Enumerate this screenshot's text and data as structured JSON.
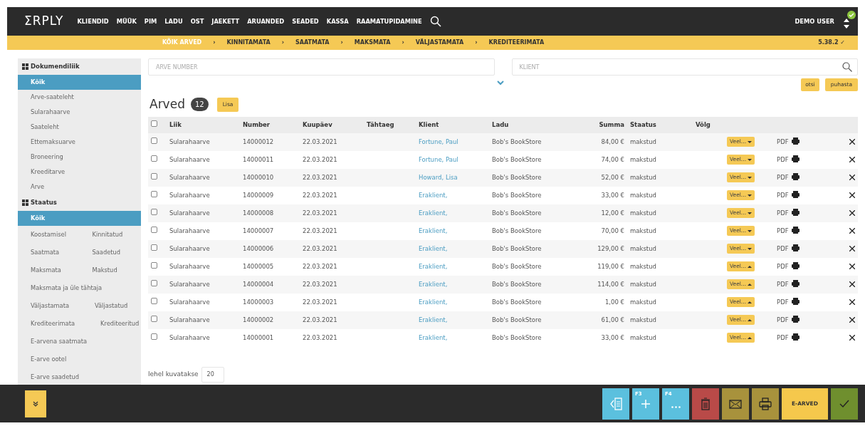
{
  "brand": "ΣRPLY",
  "menu": [
    "KLIENDID",
    "MÜÜK",
    "PIM",
    "LADU",
    "OST",
    "JAEKETT",
    "ARUANDED",
    "SEADED",
    "KASSA",
    "RAAMATUPIDAMINE"
  ],
  "user": {
    "name": "DEMO USER",
    "online": true
  },
  "subnav": [
    {
      "label": "KÕIK ARVED",
      "selected": true
    },
    {
      "separator": "›",
      "label": "KINNITAMATA",
      "selected": false
    },
    {
      "separator": "›",
      "label": "SAATMATA",
      "selected": false
    },
    {
      "separator": "›",
      "label": "MAKSMATA",
      "selected": false
    },
    {
      "separator": "›",
      "label": "VÄLJASTAMATA",
      "selected": false
    },
    {
      "separator": "›",
      "label": "KREDITEERIMATA",
      "selected": false
    }
  ],
  "version": "5.38.2 ✓",
  "sidebar": [
    {
      "title": "Dokumendiliik",
      "items": [
        [
          {
            "label": "Kõik",
            "selected": true
          }
        ],
        [
          {
            "label": "Arve-saateleht",
            "selected": false
          }
        ],
        [
          {
            "label": "Sularahaarve",
            "selected": false
          }
        ],
        [
          {
            "label": "Saateleht",
            "selected": false
          }
        ],
        [
          {
            "label": "Ettemaksuarve",
            "selected": false
          }
        ],
        [
          {
            "label": "Broneering",
            "selected": false
          }
        ],
        [
          {
            "label": "Kreeditarve",
            "selected": false
          }
        ],
        [
          {
            "label": "Arve",
            "selected": false
          }
        ]
      ]
    },
    {
      "title": "Staatus",
      "items": [
        [
          {
            "label": "Kõik",
            "selected": true
          }
        ],
        [
          {
            "label": "Koostamisel",
            "selected": false
          },
          {
            "label": "Kinnitatud",
            "selected": false
          }
        ],
        [
          {
            "label": "Saatmata",
            "selected": false
          },
          {
            "label": "Saadetud",
            "selected": false
          }
        ],
        [
          {
            "label": "Maksmata",
            "selected": false
          },
          {
            "label": "Makstud",
            "selected": false
          }
        ],
        [
          {
            "label": "Maksmata ja üle tähtaja",
            "selected": false
          }
        ],
        [
          {
            "label": "Väljastamata",
            "selected": false
          },
          {
            "label": "Väljastatud",
            "selected": false
          }
        ],
        [
          {
            "label": "Krediteerimata",
            "selected": false
          },
          {
            "label": "Krediteeritud",
            "selected": false
          }
        ],
        [
          {
            "label": "E-arvena saatmata",
            "selected": false
          }
        ],
        [
          {
            "label": "E-arve ootel",
            "selected": false
          }
        ],
        [
          {
            "label": "E-arve saadetud",
            "selected": false
          }
        ]
      ]
    }
  ],
  "filters": {
    "number_placeholder": "ARVE NUMBER",
    "client_placeholder": "KLIENT",
    "search_button": "otsi",
    "clear_button": "puhasta"
  },
  "heading": {
    "title": "Arved",
    "count": "12",
    "add_button": "Lisa"
  },
  "table": {
    "all_checked": false,
    "columns": [
      "Liik",
      "Number",
      "Kuupäev",
      "Tähtaeg",
      "Klient",
      "Ladu",
      "Summa",
      "Staatus",
      "Võlg"
    ],
    "rows": [
      {
        "checked": false,
        "type": "Sularahaarve",
        "number": "14000012",
        "date": "22.03.2021",
        "client": "Fortune, Paul",
        "store": "Bob's BookStore",
        "sum": "84,00 €",
        "status": "makstud",
        "more": "Veel...",
        "expanded": false,
        "pdf": "PDF"
      },
      {
        "checked": false,
        "type": "Sularahaarve",
        "number": "14000011",
        "date": "22.03.2021",
        "client": "Fortune, Paul",
        "store": "Bob's BookStore",
        "sum": "74,00 €",
        "status": "makstud",
        "more": "Veel...",
        "expanded": false,
        "pdf": "PDF"
      },
      {
        "checked": false,
        "type": "Sularahaarve",
        "number": "14000010",
        "date": "22.03.2021",
        "client": "Howard, Lisa",
        "store": "Bob's BookStore",
        "sum": "52,00 €",
        "status": "makstud",
        "more": "Veel...",
        "expanded": false,
        "pdf": "PDF"
      },
      {
        "checked": false,
        "type": "Sularahaarve",
        "number": "14000009",
        "date": "22.03.2021",
        "client": "Eraklient,",
        "store": "Bob's BookStore",
        "sum": "33,00 €",
        "status": "makstud",
        "more": "Veel...",
        "expanded": false,
        "pdf": "PDF"
      },
      {
        "checked": false,
        "type": "Sularahaarve",
        "number": "14000008",
        "date": "22.03.2021",
        "client": "Eraklient,",
        "store": "Bob's BookStore",
        "sum": "12,00 €",
        "status": "makstud",
        "more": "Veel...",
        "expanded": false,
        "pdf": "PDF"
      },
      {
        "checked": false,
        "type": "Sularahaarve",
        "number": "14000007",
        "date": "22.03.2021",
        "client": "Eraklient,",
        "store": "Bob's BookStore",
        "sum": "70,00 €",
        "status": "makstud",
        "more": "Veel...",
        "expanded": false,
        "pdf": "PDF"
      },
      {
        "checked": false,
        "type": "Sularahaarve",
        "number": "14000006",
        "date": "22.03.2021",
        "client": "Eraklient,",
        "store": "Bob's BookStore",
        "sum": "129,00 €",
        "status": "makstud",
        "more": "Veel...",
        "expanded": false,
        "pdf": "PDF"
      },
      {
        "checked": false,
        "type": "Sularahaarve",
        "number": "14000005",
        "date": "22.03.2021",
        "client": "Eraklient,",
        "store": "Bob's BookStore",
        "sum": "119,00 €",
        "status": "makstud",
        "more": "Veel...",
        "expanded": true,
        "pdf": "PDF"
      },
      {
        "checked": false,
        "type": "Sularahaarve",
        "number": "14000004",
        "date": "22.03.2021",
        "client": "Eraklient,",
        "store": "Bob's BookStore",
        "sum": "114,00 €",
        "status": "makstud",
        "more": "Veel...",
        "expanded": true,
        "pdf": "PDF"
      },
      {
        "checked": false,
        "type": "Sularahaarve",
        "number": "14000003",
        "date": "22.03.2021",
        "client": "Eraklient,",
        "store": "Bob's BookStore",
        "sum": "1,00 €",
        "status": "makstud",
        "more": "Veel...",
        "expanded": true,
        "pdf": "PDF"
      },
      {
        "checked": false,
        "type": "Sularahaarve",
        "number": "14000002",
        "date": "22.03.2021",
        "client": "Eraklient,",
        "store": "Bob's BookStore",
        "sum": "61,00 €",
        "status": "makstud",
        "more": "Veel...",
        "expanded": true,
        "pdf": "PDF"
      },
      {
        "checked": false,
        "type": "Sularahaarve",
        "number": "14000001",
        "date": "22.03.2021",
        "client": "Eraklient,",
        "store": "Bob's BookStore",
        "sum": "33,00 €",
        "status": "makstud",
        "more": "Veel...",
        "expanded": true,
        "pdf": "PDF"
      }
    ]
  },
  "page_size": {
    "label": "lehel kuvatakse",
    "value": "20"
  },
  "toolbar": [
    {
      "kind": "back",
      "color": "#5bc0de"
    },
    {
      "kind": "add",
      "key": "F3",
      "color": "#5bc0de"
    },
    {
      "kind": "more",
      "key": "F4",
      "color": "#5bc0de"
    },
    {
      "kind": "delete",
      "color": "#b94a48"
    },
    {
      "kind": "mail",
      "color": "#a8923c"
    },
    {
      "kind": "print",
      "color": "#a8923c"
    },
    {
      "kind": "text",
      "label": "E-ARVED",
      "color": "#f5c84c"
    },
    {
      "kind": "confirm",
      "color": "#6f8f2e"
    }
  ]
}
